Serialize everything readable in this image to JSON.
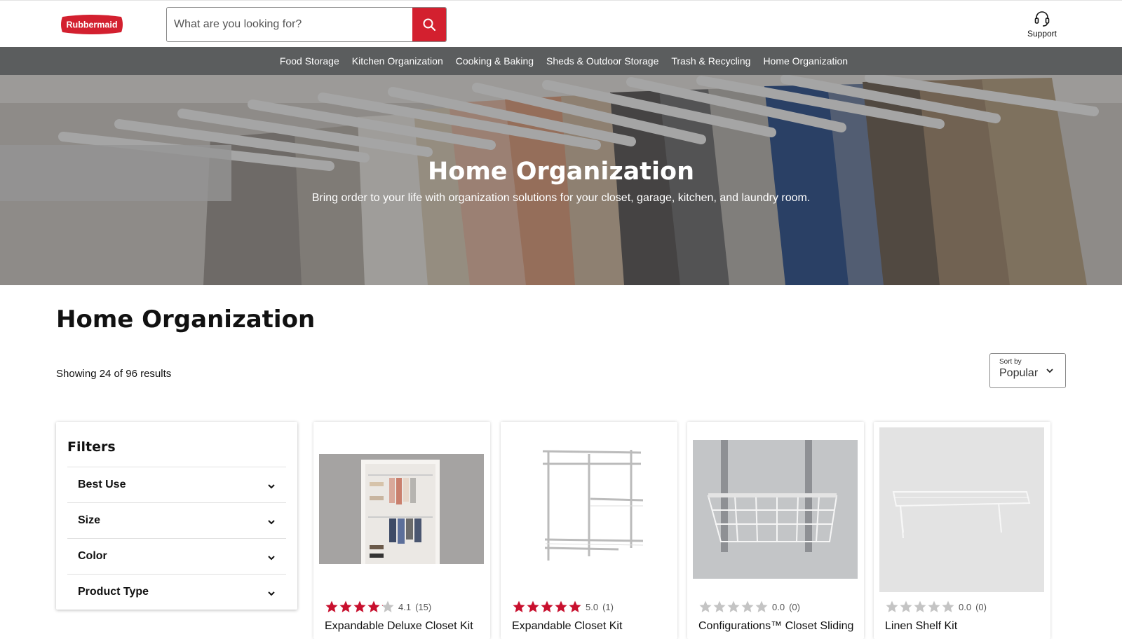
{
  "header": {
    "logo_text": "Rubbermaid",
    "search_placeholder": "What are you looking for?",
    "support_label": "Support"
  },
  "nav": {
    "items": [
      "Food Storage",
      "Kitchen Organization",
      "Cooking & Baking",
      "Sheds & Outdoor Storage",
      "Trash & Recycling",
      "Home Organization"
    ]
  },
  "hero": {
    "title": "Home Organization",
    "subtitle": "Bring order to your life with organization solutions for your closet, garage, kitchen, and laundry room."
  },
  "page": {
    "title": "Home Organization",
    "results_text": "Showing 24 of 96 results"
  },
  "sort": {
    "label": "Sort by",
    "value": "Popular"
  },
  "filters": {
    "title": "Filters",
    "items": [
      "Best Use",
      "Size",
      "Color",
      "Product Type"
    ]
  },
  "products": [
    {
      "name": "Expandable Deluxe Closet Kit",
      "rating": 4.1,
      "rating_text": "4.1",
      "count_text": "(15)"
    },
    {
      "name": "Expandable Closet Kit",
      "rating": 5.0,
      "rating_text": "5.0",
      "count_text": "(1)"
    },
    {
      "name": "Configurations™ Closet Sliding",
      "rating": 0.0,
      "rating_text": "0.0",
      "count_text": "(0)"
    },
    {
      "name": "Linen Shelf Kit",
      "rating": 0.0,
      "rating_text": "0.0",
      "count_text": "(0)"
    }
  ],
  "colors": {
    "brand_red": "#d3202f",
    "nav_bg": "#5b5d5e",
    "star_filled": "#c8102e",
    "star_empty": "#c4c4c4"
  },
  "icons": {
    "search": "search-icon",
    "support": "headset-icon",
    "chevron": "chevron-down-icon",
    "star": "star-icon"
  }
}
